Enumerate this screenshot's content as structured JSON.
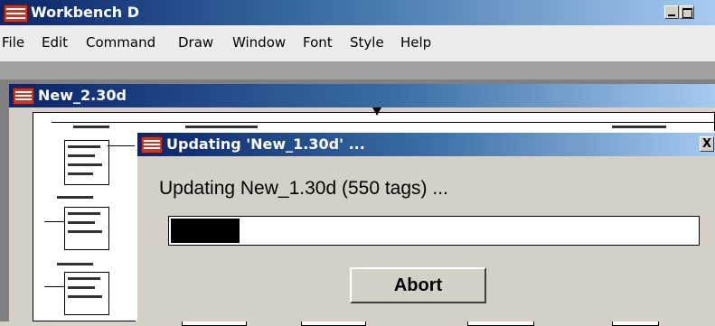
{
  "app": {
    "title": "Workbench D",
    "window_buttons": {
      "minimize": "minimize-icon",
      "maximize": "maximize-icon"
    }
  },
  "menu": {
    "items": [
      "File",
      "Edit",
      "Command",
      "Draw",
      "Window",
      "Font",
      "Style",
      "Help"
    ]
  },
  "document": {
    "title": "New_2.30d"
  },
  "dialog": {
    "title": "Updating 'New_1.30d' ...",
    "close_label": "X",
    "message": "Updating New_1.30d (550 tags) ...",
    "progress": 0.13,
    "abort_label": "Abort"
  },
  "colors": {
    "title_bar": "#0a246a",
    "app_icon": "#c0392b",
    "progress_fill": "#000000"
  }
}
